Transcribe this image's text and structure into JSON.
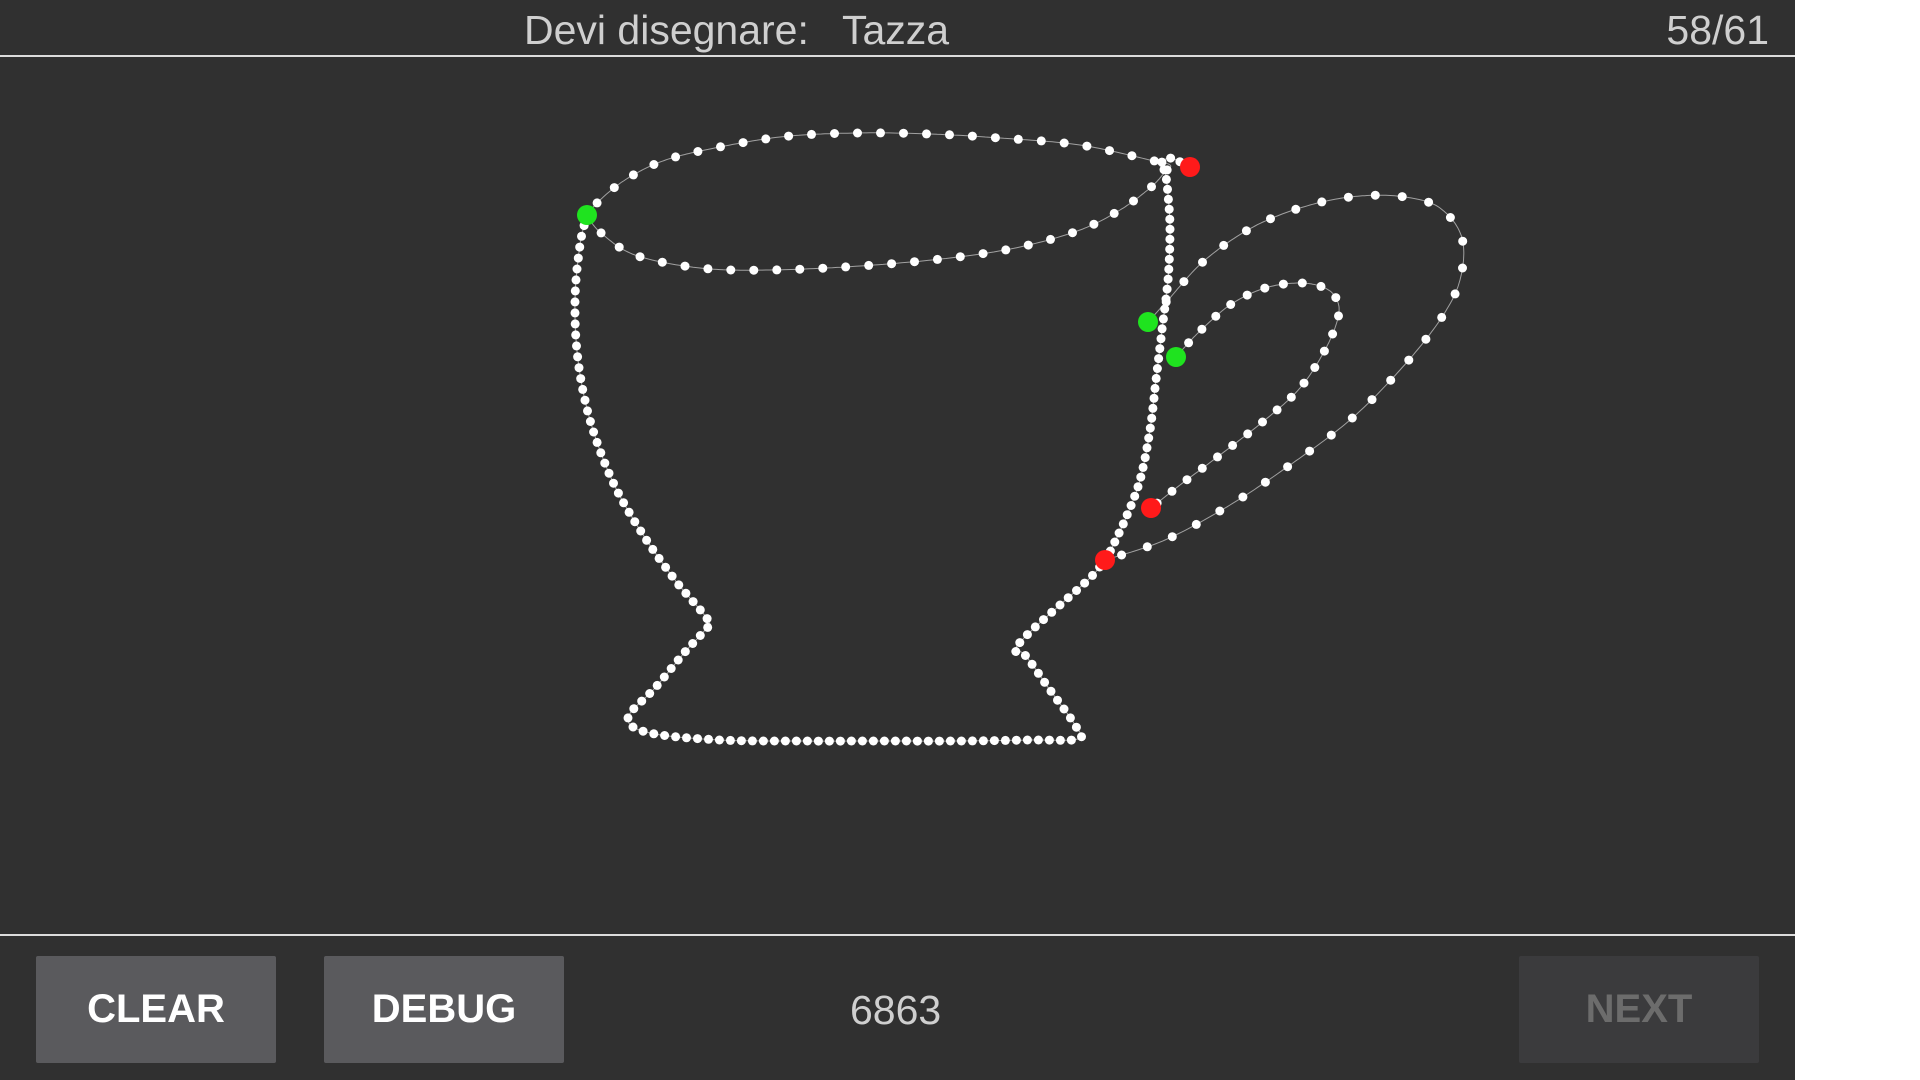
{
  "header": {
    "prompt_label": "Devi disegnare:",
    "prompt_word": "Tazza",
    "progress": "58/61"
  },
  "footer": {
    "clear_label": "CLEAR",
    "debug_label": "DEBUG",
    "score": "6863",
    "next_label": "NEXT"
  },
  "colors": {
    "background": "#303030",
    "stroke_point": "#ffffff",
    "stroke_start": "#1fe31f",
    "stroke_end": "#ff1a1a",
    "divider": "#dcdcdc"
  }
}
